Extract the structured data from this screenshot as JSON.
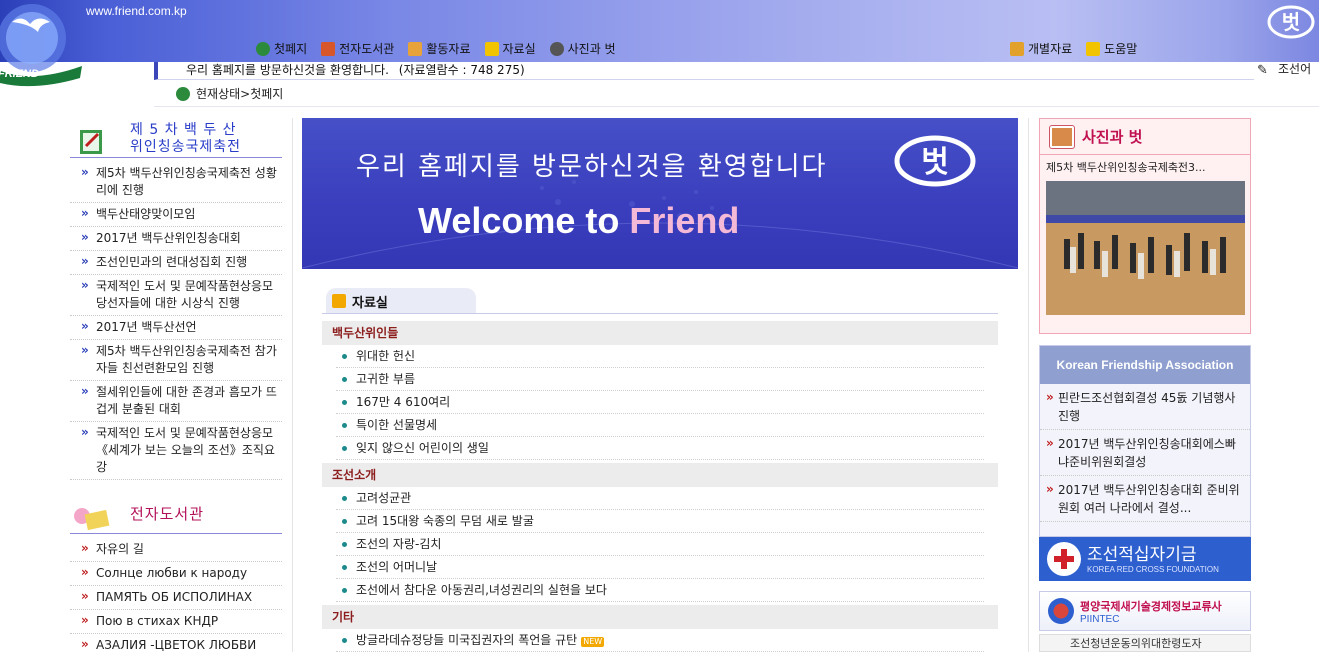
{
  "header": {
    "site_url": "www.friend.com.kp",
    "logo_text": "FRIEND",
    "badge_text": "벗",
    "nav": [
      {
        "label": "첫페지",
        "icon": "home-icon"
      },
      {
        "label": "전자도서관",
        "icon": "book-icon"
      },
      {
        "label": "활동자료",
        "icon": "activity-icon"
      },
      {
        "label": "자료실",
        "icon": "folder-icon"
      },
      {
        "label": "사진과 벗",
        "icon": "camera-icon"
      }
    ],
    "nav_right": [
      {
        "label": "개별자료",
        "icon": "document-icon"
      },
      {
        "label": "도움말",
        "icon": "help-icon"
      }
    ],
    "welcome_text": "우리 홈페지를 방문하신것을 환영합니다.",
    "visit_count": "(자료열람수 : 748 275)",
    "language": "조선어"
  },
  "breadcrumb": {
    "text": "현재상태>첫페지"
  },
  "sidebar": {
    "festival_title_line1": "제 5 차  백 두 산",
    "festival_title_line2": "위인칭송국제축전",
    "festival_items": [
      "제5차 백두산위인칭송국제축전 성황리에 진행",
      "백두산태양맞이모임",
      "2017년 백두산위인칭송대회",
      "조선인민과의 련대성집회 진행",
      "국제적인 도서 및 문예작품현상응모 당선자들에 대한 시상식 진행",
      "2017년 백두산선언",
      "제5차 백두산위인칭송국제축전 참가자들 친선련환모임 진행",
      "절세위인들에 대한 존경과 흠모가 뜨겁게 분출된 대회",
      "국제적인 도서 및 문예작품현상응모《세계가 보는 오늘의 조선》조직요강"
    ],
    "library_title": "전자도서관",
    "library_items": [
      "자유의 길",
      "Солнце любви к  народу",
      "ПАМЯТЬ ОБ ИСПОЛИНАХ",
      "Пою в стихах КНДР",
      "АЗАЛИЯ -ЦВЕТОК ЛЮБВИ"
    ]
  },
  "banner": {
    "korean": "우리 홈페지를 방문하신것을 환영합니다",
    "english_prefix": "Welcome to ",
    "english_highlight": "Friend",
    "badge_text": "벗"
  },
  "data_room": {
    "title": "자료실",
    "categories": [
      {
        "name": "백두산위인들",
        "items": [
          "위대한 헌신",
          "고귀한 부름",
          "167만 4 610여리",
          "특이한 선물명세",
          "잊지 않으신 어린이의 생일"
        ]
      },
      {
        "name": "조선소개",
        "items": [
          "고려성균관",
          "고려 15대왕 숙종의 무덤 새로 발굴",
          "조선의 자랑-김치",
          "조선의 어머니날",
          "조선에서 참다운 아동권리,녀성권리의 실현을 보다"
        ]
      },
      {
        "name": "기타",
        "items": [
          "방글라데슈정당들 미국집권자의 폭언을 규탄"
        ]
      }
    ],
    "new_badge": "NEW"
  },
  "right": {
    "photo_title": "사진과 벗",
    "photo_caption": "제5차 백두산위인칭송국제축전3...",
    "kfa_title": "Korean Friendship Association",
    "kfa_items": [
      "핀란드조선협회결성 45돐 기념행사 진행",
      "2017년 백두산위인칭송대회에스빠냐준비위원회결성",
      "2017년 백두산위인칭송대회 준비위원회 여러 나라에서 결성..."
    ],
    "redcross_title": "조선적십자기금",
    "redcross_sub": "KOREA RED CROSS FOUNDATION",
    "piintec_kr": "평양국제새기술경제정보교류사",
    "piintec_en": "PIINTEC",
    "bottom_banner": "조선청년운동의위대한령도자"
  },
  "colors": {
    "accent": "#2b3fb8",
    "festival_title": "#2a3dc8",
    "library_title": "#b3125a",
    "category_text": "#8c1d1d",
    "redcross_bg": "#2d5fcf"
  }
}
